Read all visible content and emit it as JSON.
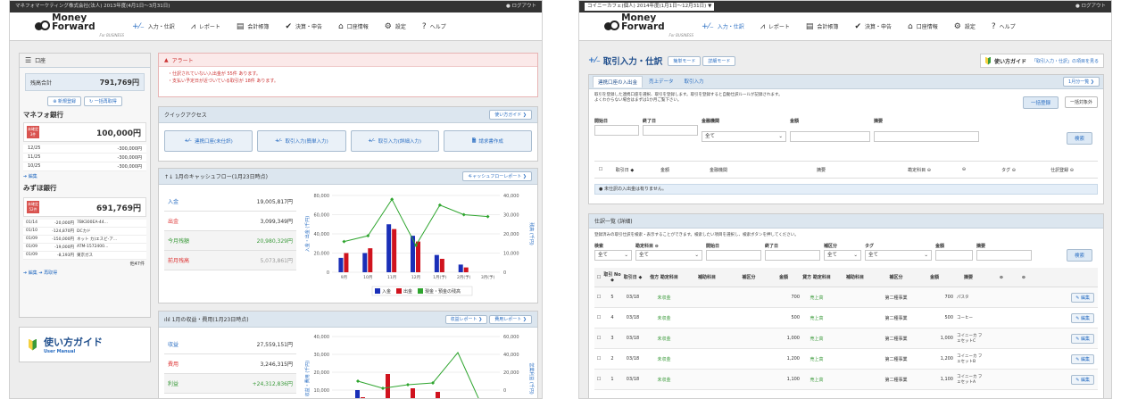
{
  "s1": {
    "topbar": {
      "left": "マネフォマーケティング株式会社(法人) 2013年度(4月1日〜3月31日)",
      "right": "● ログアウト"
    },
    "logo": {
      "name": "Money Forward",
      "sub": "For BUSINESS"
    },
    "nav": [
      "入力・仕訳",
      "レポート",
      "会計帳簿",
      "決算・申告",
      "口座情報",
      "設定",
      "ヘルプ"
    ],
    "sidebar": {
      "title": "口座",
      "total_label": "残高合計",
      "total_value": "791,769円",
      "new_btn": "新規登録",
      "refresh_btn": "一括再取得",
      "bank1": {
        "name": "マネフォ銀行",
        "badge": "未確定\n3件",
        "balance": "100,000円",
        "rows": [
          [
            "12/25",
            "-300,000円"
          ],
          [
            "11/25",
            "-300,000円"
          ],
          [
            "10/25",
            "-300,000円"
          ]
        ]
      },
      "edit": "編集",
      "bank2": {
        "name": "みずほ銀行",
        "badge": "未確定\n52件",
        "balance": "691,769円",
        "rows": [
          [
            "01/14",
            "-20,000円",
            "7BK300EA-44..."
          ],
          [
            "01/10",
            "-124,870円",
            "DCカド"
          ],
          [
            "01/09",
            "-150,000円",
            "ネット カ)エスビ-ア..."
          ],
          [
            "01/09",
            "-19,000円",
            "ATM-1572400..."
          ],
          [
            "01/09",
            "-8,193円",
            "東京ガス"
          ]
        ],
        "more": "他47件"
      },
      "edit2": "編集 ➔ 再取得",
      "guide": {
        "title": "使い方ガイド",
        "sub": "User Manual"
      }
    },
    "alert": {
      "title": "アラート",
      "lines": [
        "・仕訳されていない入出金が 55件 あります。",
        "・支払い予定日が近づいている取引が 18件 あります。"
      ]
    },
    "quick": {
      "title": "クイックアクセス",
      "guide_btn": "使い方ガイド ❯",
      "items": [
        "連携口座(未仕訳)",
        "取引入力(簡単入力)",
        "取引入力(詳細入力)",
        "請求書作成"
      ]
    },
    "cashflow": {
      "title": "1月のキャッシュフロー(1月23日時点)",
      "btn": "キャッシュフローレポート ❯",
      "rows": [
        [
          "入金",
          "19,005,817円"
        ],
        [
          "出金",
          "3,099,349円"
        ],
        [
          "今月残額",
          "20,980,329円"
        ],
        [
          "前月残高",
          "5,073,861円"
        ]
      ],
      "legend": [
        "入金",
        "出金",
        "現金・預金の残高"
      ]
    },
    "income": {
      "title": "1月の収益・費用(1月23日時点)",
      "btn1": "収益レポート ❯",
      "btn2": "費用レポート ❯",
      "rows": [
        [
          "収益",
          "27,559,151円"
        ],
        [
          "費用",
          "3,246,315円"
        ],
        [
          "利益",
          "+24,312,836円"
        ]
      ]
    },
    "chart_data": [
      {
        "type": "bar",
        "categories": [
          "9月",
          "10月",
          "11月",
          "12月",
          "1月(予)",
          "2月(予)",
          "3月(予)"
        ],
        "series": [
          {
            "name": "入金",
            "values": [
              15000,
              20000,
              50000,
              38000,
              18000,
              8000,
              0
            ]
          },
          {
            "name": "出金",
            "values": [
              20000,
              25000,
              45000,
              32000,
              14000,
              5000,
              0
            ]
          },
          {
            "name": "現金・預金の残高",
            "type": "line",
            "values": [
              16000,
              19000,
              38000,
              14000,
              35000,
              30000,
              29000
            ]
          }
        ],
        "ylabel": "入金・出金 (千円)",
        "y2label": "残高 (千円)",
        "ylim": [
          0,
          80000
        ],
        "y2lim": [
          0,
          40000
        ],
        "yticks": [
          "80,000",
          "60,000",
          "40,000",
          "20,000",
          "0"
        ],
        "y2ticks": [
          "40,000",
          "30,000",
          "20,000",
          "10,000",
          "0"
        ]
      },
      {
        "type": "bar",
        "ylabel": "収益・費用 (千円)",
        "y2label": "営業利益 (千円)",
        "yticks": [
          "40,000",
          "30,000",
          "20,000",
          "10,000"
        ],
        "y2ticks": [
          "60,000",
          "40,000",
          "20,000",
          "0"
        ]
      }
    ]
  },
  "s2": {
    "topbar": {
      "left": "コイニーカフェ(個人) 2014年度(1月1日〜12月31日) ▼",
      "right": "● ログアウト"
    },
    "logo": {
      "name": "Money Forward",
      "sub": "For BUSINESS"
    },
    "nav": [
      "入力・仕訳",
      "レポート",
      "会計帳簿",
      "決算・申告",
      "口座情報",
      "設定",
      "ヘルプ"
    ],
    "page_title": "取引入力・仕訳",
    "mode1": "簡単モード",
    "mode2": "詳細モード",
    "guide": "使い方ガイド",
    "guide_link": "「取引入力・仕訳」の項目を見る",
    "tabs": [
      "連携口座の入出金",
      "売上データ",
      "取引入力"
    ],
    "month_btn": "1月分一覧 ❯",
    "desc": [
      "取引を登録した連携口座を選択、取引を登録します。取引を登録すると自動仕訳ルールが記録されます。",
      "よくわからない場合はまずは1か月ご覧下さい。"
    ],
    "bulk_btn": "一括登録",
    "bulk_exclude": "一括対象外",
    "filter1": {
      "labels": [
        "開始日",
        "終了日",
        "金融機関",
        "金額",
        "摘要"
      ],
      "select": "全て",
      "search": "検索"
    },
    "table1": {
      "headers": [
        "取引日 ◆",
        "金額",
        "金融機関",
        "摘要",
        "勘定科目 ⊖",
        "⊖",
        "タグ ⊖",
        "仕訳登録 ⊖"
      ],
      "empty": "未仕訳の入出金は有りません。"
    },
    "list": {
      "title": "仕訳一覧 (詳細)",
      "desc": "登録済みの取引仕訳を検索・表示することができます。検索したい項目を選択し、検索ボタンを押してください。",
      "filter_labels": [
        "検索",
        "勘定科目 ⊖",
        "開始日",
        "終了日",
        "補区分",
        "タグ",
        "金額",
        "摘要"
      ],
      "select": "全て",
      "search": "検索",
      "headers": [
        "取引 No ◆",
        "取引日 ◆",
        "借方 勘定科目",
        "補助科目",
        "補区分",
        "金額",
        "貸方 勘定科目",
        "補助科目",
        "補区分",
        "金額",
        "摘要",
        "⊖",
        "⊖"
      ],
      "rows": [
        [
          "5",
          "03/18",
          "未収金",
          "",
          "",
          "700",
          "売上高",
          "",
          "第二種事業",
          "700",
          "パスタ",
          "編集"
        ],
        [
          "4",
          "03/18",
          "未収金",
          "",
          "",
          "500",
          "売上高",
          "",
          "第二種事業",
          "500",
          "コーヒー",
          "編集"
        ],
        [
          "3",
          "03/18",
          "未収金",
          "",
          "",
          "1,000",
          "売上高",
          "",
          "第二種事業",
          "1,000",
          "コイニーカ フェセットC",
          "編集"
        ],
        [
          "2",
          "03/18",
          "未収金",
          "",
          "",
          "1,200",
          "売上高",
          "",
          "第二種事業",
          "1,200",
          "コイニーカ フェセットB",
          "編集"
        ],
        [
          "1",
          "03/18",
          "未収金",
          "",
          "",
          "1,100",
          "売上高",
          "",
          "第二種事業",
          "1,100",
          "コイニーカ フェセットA",
          "編集"
        ]
      ]
    }
  }
}
